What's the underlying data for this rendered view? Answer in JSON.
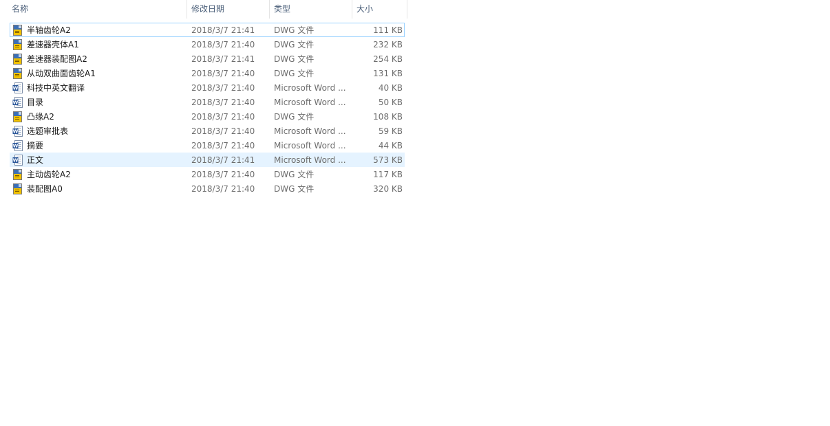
{
  "header": {
    "name": "名称",
    "date": "修改日期",
    "type": "类型",
    "size": "大小",
    "sort_arrow": "^"
  },
  "files": [
    {
      "name": "半轴齿轮A2",
      "date": "2018/3/7 21:41",
      "type": "DWG 文件",
      "size": "111 KB",
      "icon": "dwg-file-icon"
    },
    {
      "name": "差速器壳体A1",
      "date": "2018/3/7 21:40",
      "type": "DWG 文件",
      "size": "232 KB",
      "icon": "dwg-file-icon"
    },
    {
      "name": "差速器装配图A2",
      "date": "2018/3/7 21:41",
      "type": "DWG 文件",
      "size": "254 KB",
      "icon": "dwg-file-icon"
    },
    {
      "name": "从动双曲面齿轮A1",
      "date": "2018/3/7 21:40",
      "type": "DWG 文件",
      "size": "131 KB",
      "icon": "dwg-file-icon"
    },
    {
      "name": "科技中英文翻译",
      "date": "2018/3/7 21:40",
      "type": "Microsoft Word ...",
      "size": "40 KB",
      "icon": "word-file-icon"
    },
    {
      "name": "目录",
      "date": "2018/3/7 21:40",
      "type": "Microsoft Word ...",
      "size": "50 KB",
      "icon": "word-file-icon"
    },
    {
      "name": "凸缘A2",
      "date": "2018/3/7 21:40",
      "type": "DWG 文件",
      "size": "108 KB",
      "icon": "dwg-file-icon"
    },
    {
      "name": "选题审批表",
      "date": "2018/3/7 21:40",
      "type": "Microsoft Word ...",
      "size": "59 KB",
      "icon": "word-file-icon"
    },
    {
      "name": "摘要",
      "date": "2018/3/7 21:40",
      "type": "Microsoft Word ...",
      "size": "44 KB",
      "icon": "word-file-icon"
    },
    {
      "name": "正文",
      "date": "2018/3/7 21:41",
      "type": "Microsoft Word ...",
      "size": "573 KB",
      "icon": "word-file-icon"
    },
    {
      "name": "主动齿轮A2",
      "date": "2018/3/7 21:40",
      "type": "DWG 文件",
      "size": "117 KB",
      "icon": "dwg-file-icon"
    },
    {
      "name": "装配图A0",
      "date": "2018/3/7 21:40",
      "type": "DWG 文件",
      "size": "320 KB",
      "icon": "dwg-file-icon"
    }
  ],
  "state": {
    "focused_index": 0,
    "hover_index": 9
  },
  "colors": {
    "focus_border": "#99d1ff",
    "hover_bg": "#e5f3ff",
    "header_text": "#4c607a",
    "meta_text": "#6d6d6d"
  }
}
